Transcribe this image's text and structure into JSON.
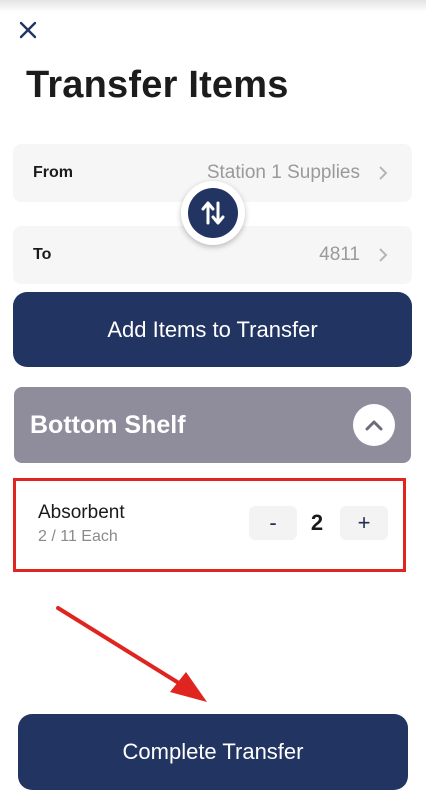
{
  "header": {
    "title": "Transfer Items"
  },
  "icons": {
    "close": "close-icon",
    "swap": "swap-vertical-icon",
    "chevron": "chevron-right-icon",
    "collapse": "chevron-up-icon"
  },
  "transfer": {
    "from_label": "From",
    "from_value": "Station 1 Supplies",
    "to_label": "To",
    "to_value": "4811"
  },
  "actions": {
    "add_items_label": "Add Items to Transfer",
    "complete_label": "Complete Transfer"
  },
  "section": {
    "title": "Bottom Shelf",
    "items": [
      {
        "name": "Absorbent",
        "qty_info": "2 / 11 Each",
        "minus_label": "-",
        "quantity": "2",
        "plus_label": "+"
      }
    ]
  },
  "colors": {
    "primary": "#223462",
    "section_header": "#8f8c9c",
    "highlight": "#e0241f",
    "row_bg": "#f6f6f6"
  }
}
